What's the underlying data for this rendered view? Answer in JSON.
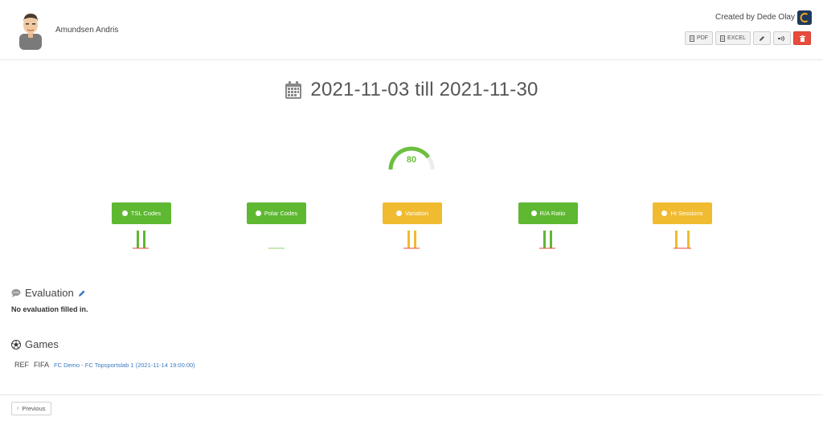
{
  "header": {
    "player_name": "Amundsen Andris",
    "created_by": "Created by Dede Olay",
    "toolbar": {
      "pdf_label": "PDF",
      "excel_label": "EXCEL"
    }
  },
  "period": {
    "text": "2021-11-03 till 2021-11-30"
  },
  "score": {
    "value": "80",
    "fraction": 0.8,
    "color": "#6cbf3f"
  },
  "metrics": [
    {
      "label": "TSL Codes",
      "color": "#5fb832",
      "status": "green"
    },
    {
      "label": "Polar Codes",
      "color": "#5fb832",
      "status": "green"
    },
    {
      "label": "Variation",
      "color": "#f0bb30",
      "status": "yellow"
    },
    {
      "label": "R/A Ratio",
      "color": "#5fb832",
      "status": "green"
    },
    {
      "label": "HI Sessions",
      "color": "#f0bb30",
      "status": "yellow"
    }
  ],
  "evaluation": {
    "title": "Evaluation",
    "empty_text": "No evaluation filled in."
  },
  "games": {
    "title": "Games",
    "rows": [
      {
        "ref": "REF",
        "type": "FIFA",
        "match": "FC Demo - FC Topsportslab 1 (2021-11-14 19:00:00)"
      }
    ]
  },
  "footer": {
    "previous_label": "Previous"
  },
  "colors": {
    "green": "#5fb832",
    "yellow": "#f0bb30",
    "red": "#e74c3c",
    "link": "#3a7abf"
  }
}
